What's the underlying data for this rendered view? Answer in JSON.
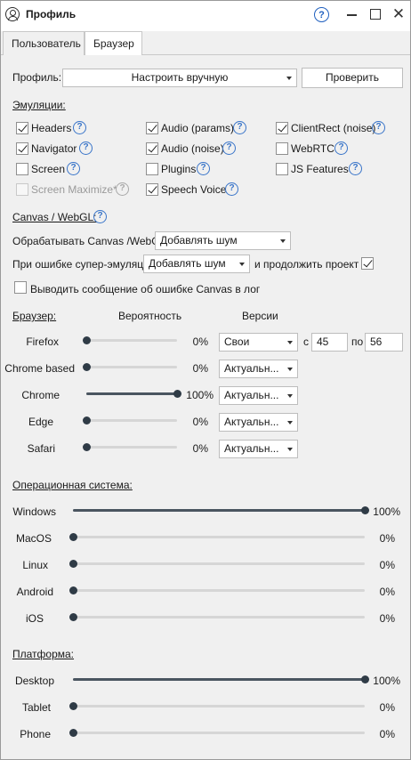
{
  "window": {
    "title": "Профиль",
    "help_glyph": "?",
    "close_glyph": "✕"
  },
  "tabs": [
    {
      "label": "Пользователь"
    },
    {
      "label": "Браузер"
    }
  ],
  "profile": {
    "label": "Профиль:",
    "value": "Настроить вручную",
    "check_button": "Проверить"
  },
  "emulations": {
    "title": "Эмуляции:",
    "items": [
      {
        "label": "Headers",
        "checked": true,
        "enabled": true
      },
      {
        "label": "Audio (params)",
        "checked": true,
        "enabled": true
      },
      {
        "label": "ClientRect (noise)",
        "checked": true,
        "enabled": true
      },
      {
        "label": "Navigator",
        "checked": true,
        "enabled": true
      },
      {
        "label": "Audio (noise)",
        "checked": true,
        "enabled": true
      },
      {
        "label": "WebRTC",
        "checked": false,
        "enabled": true
      },
      {
        "label": "Screen",
        "checked": false,
        "enabled": true
      },
      {
        "label": "Plugins",
        "checked": false,
        "enabled": true
      },
      {
        "label": "JS Features",
        "checked": false,
        "enabled": true
      },
      {
        "label": "Screen Maximize*",
        "checked": false,
        "enabled": false
      },
      {
        "label": "Speech Voice",
        "checked": true,
        "enabled": true
      }
    ]
  },
  "canvas": {
    "title": "Canvas / WebGL:",
    "process_label": "Обрабатывать Canvas /WebGL",
    "process_value": "Добавлять шум",
    "error_label": "При ошибке супер-эмуляции",
    "error_value": "Добавлять шум",
    "continue_label": "и продолжить проект",
    "continue_checked": true,
    "log_label": "Выводить сообщение об ошибке Canvas в лог",
    "log_checked": false
  },
  "browser": {
    "title": "Браузер:",
    "col_probability": "Вероятность",
    "col_versions": "Версии",
    "from_label": "с",
    "to_label": "по",
    "rows": [
      {
        "name": "Firefox",
        "percent": "0%",
        "value": 0,
        "version": "Свои",
        "from": "45",
        "to": "56"
      },
      {
        "name": "Chrome based",
        "percent": "0%",
        "value": 0,
        "version": "Актуальн..."
      },
      {
        "name": "Chrome",
        "percent": "100%",
        "value": 100,
        "version": "Актуальн..."
      },
      {
        "name": "Edge",
        "percent": "0%",
        "value": 0,
        "version": "Актуальн..."
      },
      {
        "name": "Safari",
        "percent": "0%",
        "value": 0,
        "version": "Актуальн..."
      }
    ]
  },
  "os": {
    "title": "Операционная система:",
    "rows": [
      {
        "name": "Windows",
        "percent": "100%",
        "value": 100
      },
      {
        "name": "MacOS",
        "percent": "0%",
        "value": 0
      },
      {
        "name": "Linux",
        "percent": "0%",
        "value": 0
      },
      {
        "name": "Android",
        "percent": "0%",
        "value": 0
      },
      {
        "name": "iOS",
        "percent": "0%",
        "value": 0
      }
    ]
  },
  "platform": {
    "title": "Платформа:",
    "rows": [
      {
        "name": "Desktop",
        "percent": "100%",
        "value": 100
      },
      {
        "name": "Tablet",
        "percent": "0%",
        "value": 0
      },
      {
        "name": "Phone",
        "percent": "0%",
        "value": 0
      }
    ]
  },
  "colors": {
    "accent_help": "#3a75c9",
    "slider_knob": "#2f3b46",
    "panel_bg": "#f0f0f0"
  }
}
